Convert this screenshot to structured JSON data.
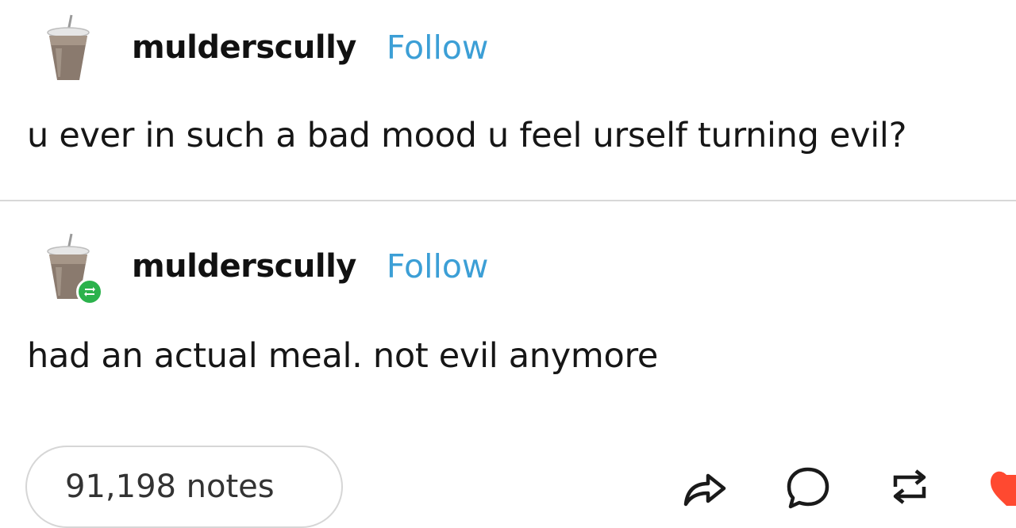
{
  "posts": [
    {
      "username": "mulderscully",
      "follow_label": "Follow",
      "text": "u ever in such a bad mood u feel urself turning evil?",
      "avatar_icon": "iced-coffee-icon"
    },
    {
      "username": "mulderscully",
      "follow_label": "Follow",
      "text": "had an actual meal. not evil anymore",
      "avatar_icon": "iced-coffee-icon",
      "badge_icon": "reblog-badge-icon"
    }
  ],
  "footer": {
    "notes": "91,198 notes",
    "actions": [
      "share-icon",
      "comment-icon",
      "reblog-icon",
      "heart-icon"
    ]
  },
  "colors": {
    "follow": "#3c9fd6",
    "reblog_badge": "#2bb24c",
    "heart": "#ff4930",
    "divider": "#d8d8d8"
  }
}
